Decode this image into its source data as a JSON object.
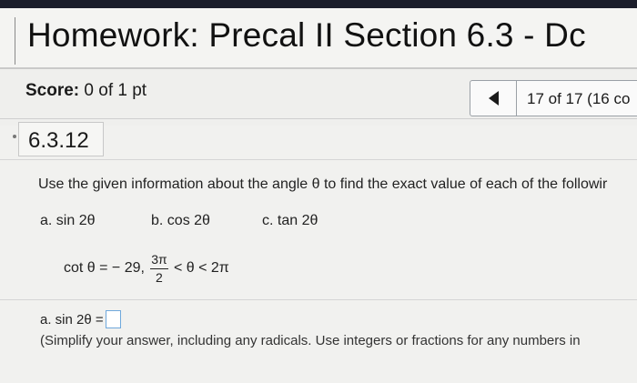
{
  "header": {
    "title": "Homework: Precal II Section 6.3 - Dc"
  },
  "score": {
    "label": "Score:",
    "value": "0 of 1 pt"
  },
  "nav": {
    "counter": "17 of 17 (16 co"
  },
  "question": {
    "number": "6.3.12",
    "instructions": "Use the given information about the angle θ to find the exact value of each of the followir",
    "options": [
      {
        "letter": "a.",
        "expr": "sin 2θ"
      },
      {
        "letter": "b.",
        "expr": "cos 2θ"
      },
      {
        "letter": "c.",
        "expr": "tan 2θ"
      }
    ],
    "given": {
      "lhs": "cot θ = − 29,",
      "frac_num": "3π",
      "frac_den": "2",
      "rhs": "< θ < 2π"
    },
    "answer_label": "a. sin 2θ =",
    "hint": "(Simplify your answer, including any radicals. Use integers or fractions for any numbers in"
  }
}
